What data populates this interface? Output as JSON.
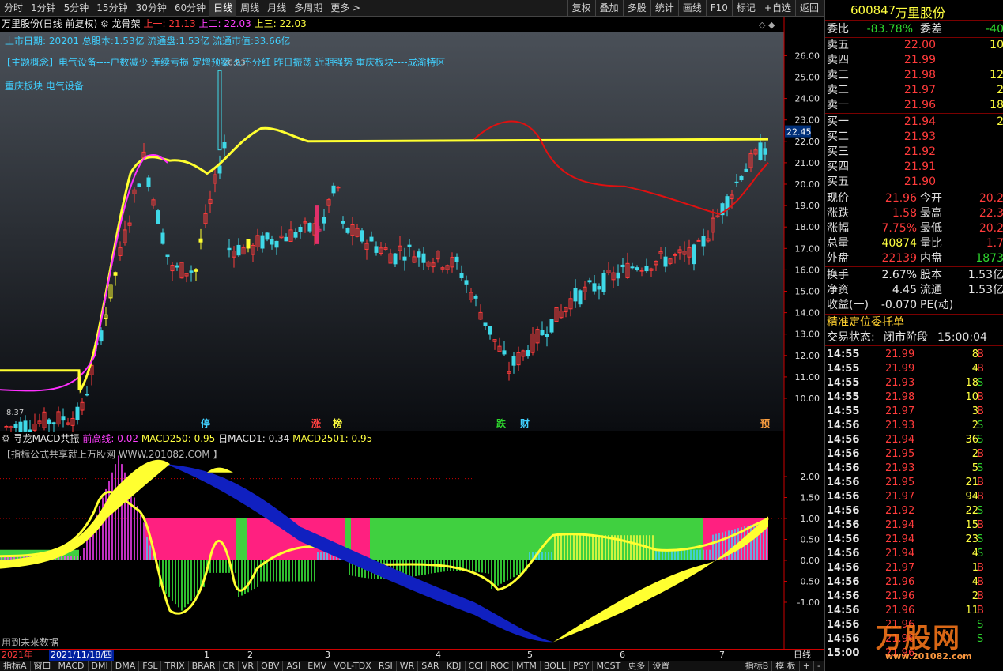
{
  "toolbar": {
    "periods": [
      "分时",
      "1分钟",
      "5分钟",
      "15分钟",
      "30分钟",
      "60分钟",
      "日线",
      "周线",
      "月线",
      "多周期",
      "更多 >"
    ],
    "active_period": "日线",
    "actions": [
      "复权",
      "叠加",
      "多股",
      "统计",
      "画线",
      "F10",
      "标记",
      "+自选",
      "返回"
    ]
  },
  "main_header": {
    "stock": "万里股份(日线 前复权)",
    "indicator": "龙骨架",
    "l1_label": "上一:",
    "l1_value": "21.13",
    "l2_label": "上二:",
    "l2_value": "22.03",
    "l3_label": "上三:",
    "l3_value": "22.03"
  },
  "overlay_info": {
    "line1": "上市日期: 20201  总股本:1.53亿 流通盘:1.53亿   流通市值:33.66亿",
    "line2": "【主题概念】电气设备----户数减少 连续亏损 定增预案 久不分红 昨日振荡 近期强势 重庆板块----成渝特区",
    "line3": "重庆板块 电气设备"
  },
  "price_axis": [
    "26.00",
    "25.00",
    "24.00",
    "23.00",
    "22.00",
    "21.00",
    "20.00",
    "19.00",
    "18.00",
    "17.00",
    "16.00",
    "15.00",
    "14.00",
    "13.00",
    "12.00",
    "11.00",
    "10.00"
  ],
  "price_marker": "22.45",
  "high_label": "26.03",
  "low_label": "8.37",
  "markers": [
    {
      "text": "停",
      "color": "#40d0ff"
    },
    {
      "text": "涨",
      "color": "#ff4040"
    },
    {
      "text": "榜",
      "color": "#ffff40"
    },
    {
      "text": "跌",
      "color": "#2ed52e"
    },
    {
      "text": "财",
      "color": "#40d0ff"
    },
    {
      "text": "预",
      "color": "#ffa040"
    }
  ],
  "sub_header": {
    "name": "寻龙MACD共振",
    "i1_label": "前高线:",
    "i1_value": "0.02",
    "i2_label": "MACD250:",
    "i2_value": "0.95",
    "i3_label": "日MACD1:",
    "i3_value": "0.34",
    "i4_label": "MACD2501:",
    "i4_value": "0.95"
  },
  "sub_notice": "【指标公式共享就上万股网 WWW.201082.COM 】",
  "sub_footer": "用到未来数据",
  "sub_axis": [
    "2.00",
    "1.50",
    "1.00",
    "0.50",
    "0.00",
    "-0.50",
    "-1.00"
  ],
  "date_axis": {
    "year": "2021年",
    "cursor_date": "2021/11/18/四",
    "months": [
      "1",
      "2",
      "3",
      "4",
      "5",
      "6",
      "7"
    ],
    "period_label": "日线"
  },
  "bottom_tabs": [
    "指标A",
    "窗口",
    "MACD",
    "DMI",
    "DMA",
    "FSL",
    "TRIX",
    "BRAR",
    "CR",
    "VR",
    "OBV",
    "ASI",
    "EMV",
    "VOL-TDX",
    "RSI",
    "WR",
    "SAR",
    "KDJ",
    "CCI",
    "ROC",
    "MTM",
    "BOLL",
    "PSY",
    "MCST",
    "更多",
    "设置"
  ],
  "bottom_right_tabs": [
    "指标B",
    "模 板",
    "+",
    "-"
  ],
  "quote": {
    "code": "600847",
    "name": "万里股份",
    "weibi_label": "委比",
    "weibi": "-83.78%",
    "weicha_label": "委差",
    "weicha": "-40",
    "asks": [
      {
        "label": "卖五",
        "price": "22.00",
        "vol": "10"
      },
      {
        "label": "卖四",
        "price": "21.99",
        "vol": ""
      },
      {
        "label": "卖三",
        "price": "21.98",
        "vol": "12"
      },
      {
        "label": "卖二",
        "price": "21.97",
        "vol": "2"
      },
      {
        "label": "卖一",
        "price": "21.96",
        "vol": "18"
      }
    ],
    "bids": [
      {
        "label": "买一",
        "price": "21.94",
        "vol": "2"
      },
      {
        "label": "买二",
        "price": "21.93",
        "vol": ""
      },
      {
        "label": "买三",
        "price": "21.92",
        "vol": ""
      },
      {
        "label": "买四",
        "price": "21.91",
        "vol": ""
      },
      {
        "label": "买五",
        "price": "21.90",
        "vol": ""
      }
    ],
    "stats": [
      {
        "l1": "现价",
        "v1": "21.96",
        "c1": "red",
        "l2": "今开",
        "v2": "20.2",
        "c2": "red"
      },
      {
        "l1": "涨跌",
        "v1": "1.58",
        "c1": "red",
        "l2": "最高",
        "v2": "22.3",
        "c2": "red"
      },
      {
        "l1": "涨幅",
        "v1": "7.75%",
        "c1": "red",
        "l2": "最低",
        "v2": "20.2",
        "c2": "red"
      },
      {
        "l1": "总量",
        "v1": "40874",
        "c1": "yellow",
        "l2": "量比",
        "v2": "1.7",
        "c2": "red"
      },
      {
        "l1": "外盘",
        "v1": "22139",
        "c1": "red",
        "l2": "内盘",
        "v2": "1873",
        "c2": "green"
      }
    ],
    "stats2": [
      {
        "l1": "换手",
        "v1": "2.67%",
        "c1": "white",
        "l2": "股本",
        "v2": "1.53亿",
        "c2": "white"
      },
      {
        "l1": "净资",
        "v1": "4.45",
        "c1": "white",
        "l2": "流通",
        "v2": "1.53亿",
        "c2": "white"
      },
      {
        "l1": "收益(一)",
        "v1": "-0.070",
        "c1": "white",
        "l2": "PE(动)",
        "v2": "",
        "c2": "white"
      }
    ],
    "precise_label": "精准定位委托单",
    "trade_state_label": "交易状态:",
    "trade_state": "闭市阶段",
    "trade_time": "15:00:04"
  },
  "ticks": [
    {
      "t": "14:55",
      "p": "21.99",
      "v": "8",
      "s": "B"
    },
    {
      "t": "14:55",
      "p": "21.99",
      "v": "4",
      "s": "B"
    },
    {
      "t": "14:55",
      "p": "21.93",
      "v": "18",
      "s": "S"
    },
    {
      "t": "14:55",
      "p": "21.98",
      "v": "10",
      "s": "B"
    },
    {
      "t": "14:55",
      "p": "21.97",
      "v": "3",
      "s": "B"
    },
    {
      "t": "14:56",
      "p": "21.93",
      "v": "2",
      "s": "S"
    },
    {
      "t": "14:56",
      "p": "21.94",
      "v": "36",
      "s": "S"
    },
    {
      "t": "14:56",
      "p": "21.95",
      "v": "2",
      "s": "B"
    },
    {
      "t": "14:56",
      "p": "21.93",
      "v": "5",
      "s": "S"
    },
    {
      "t": "14:56",
      "p": "21.95",
      "v": "21",
      "s": "B"
    },
    {
      "t": "14:56",
      "p": "21.97",
      "v": "94",
      "s": "B"
    },
    {
      "t": "14:56",
      "p": "21.92",
      "v": "22",
      "s": "S"
    },
    {
      "t": "14:56",
      "p": "21.94",
      "v": "15",
      "s": "B"
    },
    {
      "t": "14:56",
      "p": "21.94",
      "v": "23",
      "s": "S"
    },
    {
      "t": "14:56",
      "p": "21.94",
      "v": "4",
      "s": "S"
    },
    {
      "t": "14:56",
      "p": "21.97",
      "v": "1",
      "s": "B"
    },
    {
      "t": "14:56",
      "p": "21.96",
      "v": "4",
      "s": "B"
    },
    {
      "t": "14:56",
      "p": "21.96",
      "v": "2",
      "s": "B"
    },
    {
      "t": "14:56",
      "p": "21.96",
      "v": "11",
      "s": "B"
    },
    {
      "t": "14:56",
      "p": "21.96",
      "v": "",
      "s": "S"
    },
    {
      "t": "14:56",
      "p": "21.96",
      "v": "",
      "s": "S"
    },
    {
      "t": "15:00",
      "p": "21.96",
      "v": "",
      "s": ""
    }
  ],
  "watermark": {
    "brand": "万股网",
    "url": "www.201082.com"
  },
  "colors": {
    "up": "#ff3b3b",
    "down": "#3fd9e8",
    "yellow": "#ffff30",
    "red_line": "#e01010",
    "magenta": "#ff30ff",
    "blue": "#1020c0",
    "green_bar": "#40d040",
    "pink_bar": "#ff2080"
  }
}
